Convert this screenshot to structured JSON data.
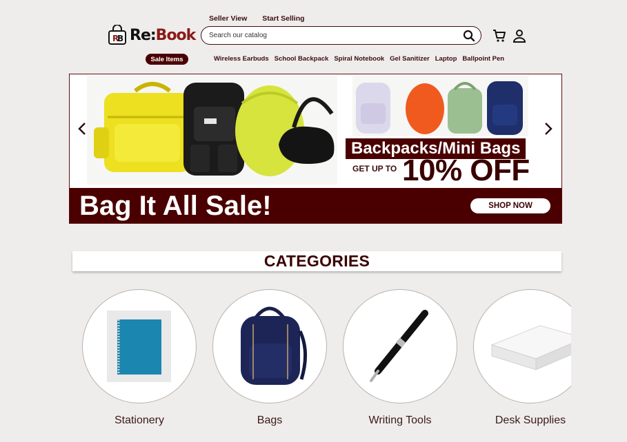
{
  "header": {
    "logo_text": "Re:",
    "logo_accent": "Book",
    "top_links": [
      "Seller View",
      "Start Selling"
    ],
    "search_placeholder": "Search our catalog",
    "sale_label": "Sale Items",
    "quick_links": [
      "Wireless Earbuds",
      "School Backpack",
      "Spiral Notebook",
      "Gel Sanitizer",
      "Laptop",
      "Ballpoint Pen"
    ],
    "icons": [
      "search-icon",
      "cart-icon",
      "user-icon"
    ]
  },
  "banner": {
    "promo_title": "Backpacks/Mini Bags",
    "get_up_to": "GET UP TO",
    "discount": "10% OFF",
    "headline": "Bag It All Sale!",
    "cta_label": "SHOP NOW"
  },
  "categories": {
    "title": "CATEGORIES",
    "items": [
      {
        "label": "Stationery"
      },
      {
        "label": "Bags"
      },
      {
        "label": "Writing Tools"
      },
      {
        "label": "Desk Supplies"
      }
    ]
  },
  "colors": {
    "brand": "#4a0000",
    "background": "#efedeb",
    "text_dark": "#3a0d0d"
  }
}
